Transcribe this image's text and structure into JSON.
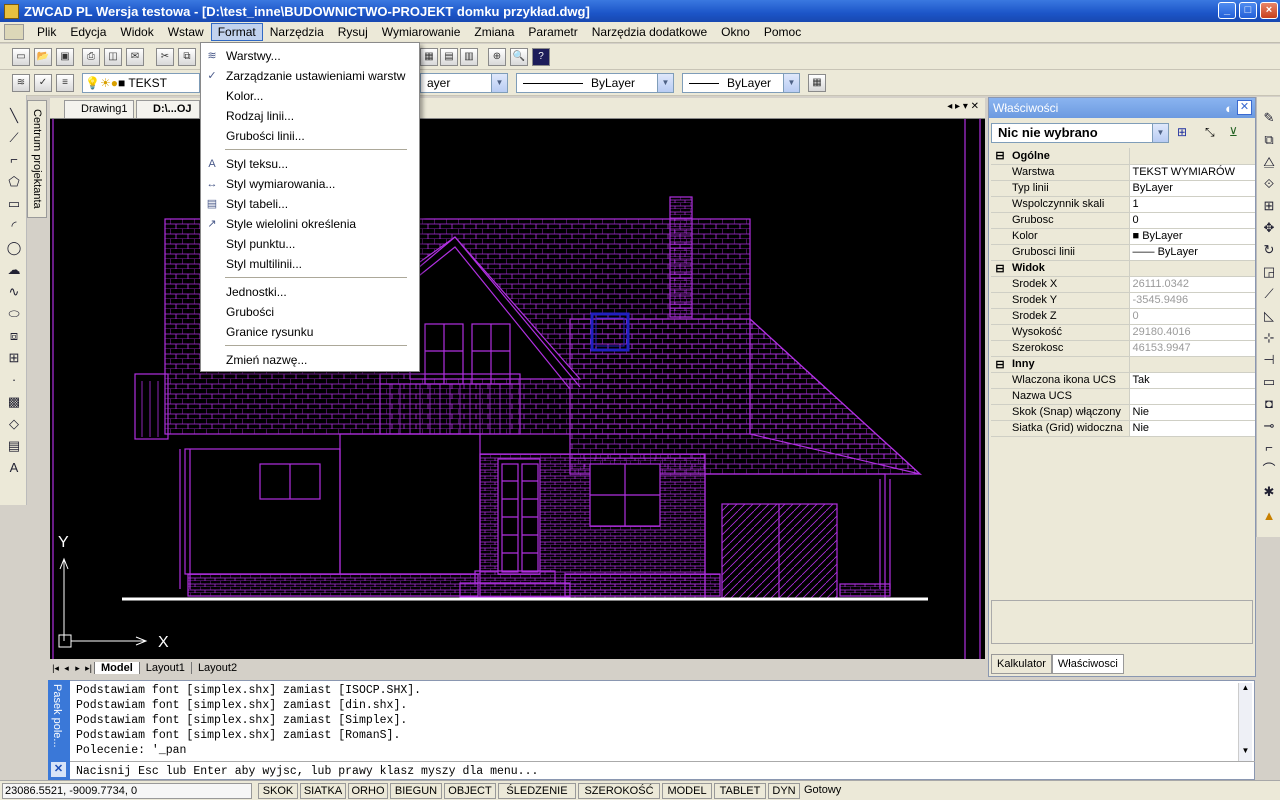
{
  "window": {
    "title": "ZWCAD PL Wersja testowa - [D:\\test_inne\\BUDOWNICTWO-PROJEKT domku przykład.dwg]"
  },
  "menubar": {
    "items": [
      "Plik",
      "Edycja",
      "Widok",
      "Wstaw",
      "Format",
      "Narzędzia",
      "Rysuj",
      "Wymiarowanie",
      "Zmiana",
      "Parametr",
      "Narzędzia dodatkowe",
      "Okno",
      "Pomoc"
    ],
    "active": "Format"
  },
  "toolbar": {
    "layer_text": "TEKST",
    "linetype_combo_1": "ayer",
    "linetype_combo_2": "ByLayer",
    "linetype_combo_3": "ByLayer"
  },
  "dropdown": {
    "items": [
      {
        "label": "Warstwy...",
        "icon": "layers-icon"
      },
      {
        "label": "Zarządzanie ustawieniami warstw",
        "icon": "layer-states-icon"
      },
      {
        "label": "Kolor...",
        "icon": ""
      },
      {
        "label": "Rodzaj linii...",
        "icon": ""
      },
      {
        "label": "Grubości linii...",
        "icon": ""
      },
      {
        "label": "Styl teksu...",
        "icon": "text-style-icon"
      },
      {
        "label": "Styl wymiarowania...",
        "icon": "dimension-style-icon"
      },
      {
        "label": "Styl tabeli...",
        "icon": "table-style-icon"
      },
      {
        "label": "Style wielolini określenia",
        "icon": "mleader-style-icon"
      },
      {
        "label": "Styl punktu...",
        "icon": ""
      },
      {
        "label": "Styl multilinii...",
        "icon": ""
      },
      {
        "label": "Jednostki...",
        "icon": ""
      },
      {
        "label": "Grubości",
        "icon": ""
      },
      {
        "label": "Granice rysunku",
        "icon": ""
      },
      {
        "label": "Zmień nazwę...",
        "icon": ""
      }
    ]
  },
  "side": {
    "centrum": "Centrum projektanta"
  },
  "doctabs": [
    "Drawing1",
    "D:\\...OJ"
  ],
  "layout_tabs": [
    "Model",
    "Layout1",
    "Layout2"
  ],
  "drawing": {
    "axis_y": "Y",
    "axis_x": "X"
  },
  "properties": {
    "title": "Właściwości",
    "selection": "Nic nie wybrano",
    "groups": [
      {
        "name": "Ogólne",
        "rows": [
          {
            "k": "Warstwa",
            "v": "TEKST WYMIARÓW"
          },
          {
            "k": "Typ linii",
            "v": "ByLayer"
          },
          {
            "k": "Wspolczynnik skali",
            "v": "1"
          },
          {
            "k": "Grubosc",
            "v": "0"
          },
          {
            "k": "Kolor",
            "v": "ByLayer"
          },
          {
            "k": "Grubosci linii",
            "v": "ByLayer"
          }
        ]
      },
      {
        "name": "Widok",
        "rows": [
          {
            "k": "Srodek X",
            "v": "26111.0342"
          },
          {
            "k": "Srodek Y",
            "v": "-3545.9496"
          },
          {
            "k": "Srodek Z",
            "v": "0"
          },
          {
            "k": "Wysokość",
            "v": "29180.4016"
          },
          {
            "k": "Szerokosc",
            "v": "46153.9947"
          }
        ]
      },
      {
        "name": "Inny",
        "rows": [
          {
            "k": "Wlaczona ikona UCS",
            "v": "Tak"
          },
          {
            "k": "Nazwa UCS",
            "v": ""
          },
          {
            "k": "Skok (Snap) włączony",
            "v": "Nie"
          },
          {
            "k": "Siatka (Grid) widoczna",
            "v": "Nie"
          }
        ]
      }
    ],
    "bottom_tabs": [
      "Kalkulator",
      "Właściwosci"
    ]
  },
  "command": {
    "side_label": "Pasek pole...",
    "lines": [
      "Podstawiam font [simplex.shx] zamiast [ISOCP.SHX].",
      "Podstawiam font [simplex.shx] zamiast [din.shx].",
      "Podstawiam font [simplex.shx] zamiast [Simplex].",
      "Podstawiam font [simplex.shx] zamiast [RomanS].",
      "Polecenie: '_pan"
    ],
    "prompt": "Nacisnij Esc lub Enter aby wyjsc, lub prawy klasz myszy dla menu..."
  },
  "status": {
    "coords": "23086.5521,  -9009.7734,  0",
    "buttons": [
      "SKOK",
      "SIATKA",
      "ORHO",
      "BIEGUN",
      "OBJECT",
      "ŚLEDZENIE",
      "SZEROKOŚĆ",
      "MODEL",
      "TABLET",
      "DYN"
    ],
    "ready": "Gotowy"
  },
  "colors": {
    "drawing": "#b030e0",
    "canvas": "#000000",
    "titlebar": "#1c55c8",
    "highlight": "#2020c0"
  }
}
